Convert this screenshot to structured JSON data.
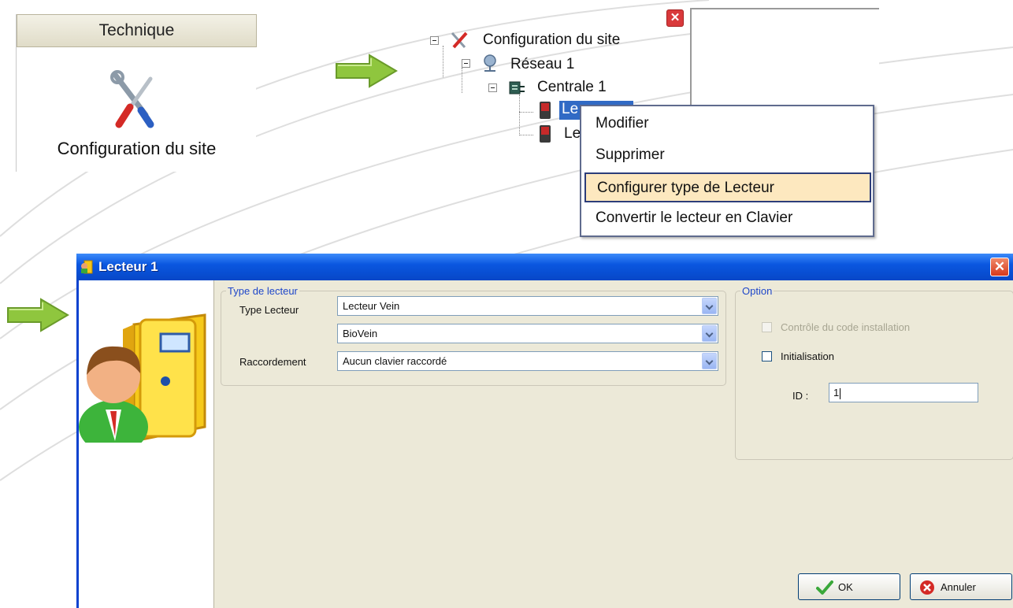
{
  "technique_panel": {
    "header": "Technique",
    "item_label": "Configuration du site"
  },
  "tree": {
    "root": "Configuration du site",
    "network": "Réseau 1",
    "central": "Centrale 1",
    "reader_selected_visible": "Le",
    "reader_other_visible": "Le"
  },
  "context_menu": {
    "items": [
      "Modifier",
      "Supprimer",
      "Configurer type de Lecteur",
      "Convertir le lecteur en Clavier"
    ]
  },
  "dialog": {
    "title": "Lecteur 1",
    "close_glyph": "✕",
    "reader_type_group": {
      "legend": "Type de lecteur",
      "type_label": "Type Lecteur",
      "type_value": "Lecteur Vein",
      "subtype_value": "BioVein",
      "connection_label": "Raccordement",
      "connection_value": "Aucun clavier raccordé"
    },
    "option_group": {
      "legend": "Option",
      "install_code_label": "Contrôle du code installation",
      "init_label": "Initialisation",
      "id_label": "ID :",
      "id_value": "1"
    },
    "buttons": {
      "ok": "OK",
      "cancel": "Annuler"
    }
  },
  "colors": {
    "xp_title_blue": "#0a57e0",
    "menu_highlight": "#fde8bf",
    "arrow_green": "#8fc63e",
    "dialog_face": "#ece9d8"
  }
}
